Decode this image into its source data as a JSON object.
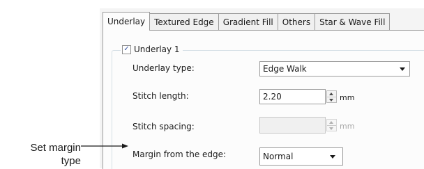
{
  "tabs": [
    {
      "label": "Underlay",
      "active": true
    },
    {
      "label": "Textured Edge",
      "active": false
    },
    {
      "label": "Gradient Fill",
      "active": false
    },
    {
      "label": "Others",
      "active": false
    },
    {
      "label": "Star & Wave Fill",
      "active": false
    }
  ],
  "underlay_group": {
    "label": "Underlay 1",
    "checked": true,
    "checkmark": "✓",
    "underlay_type": {
      "label": "Underlay type:",
      "value": "Edge Walk"
    },
    "stitch_length": {
      "label": "Stitch length:",
      "value": "2.20",
      "unit": "mm"
    },
    "stitch_spacing": {
      "label": "Stitch spacing:",
      "value": "",
      "unit": "mm",
      "disabled": true
    },
    "margin": {
      "label": "Margin from the edge:",
      "value": "Normal"
    }
  },
  "callout": {
    "line1": "Set margin",
    "line2": "type"
  },
  "colors": {
    "arrow": "#1a1a1a",
    "tab_border": "#9a9a9a",
    "check": "#3a55a0"
  }
}
